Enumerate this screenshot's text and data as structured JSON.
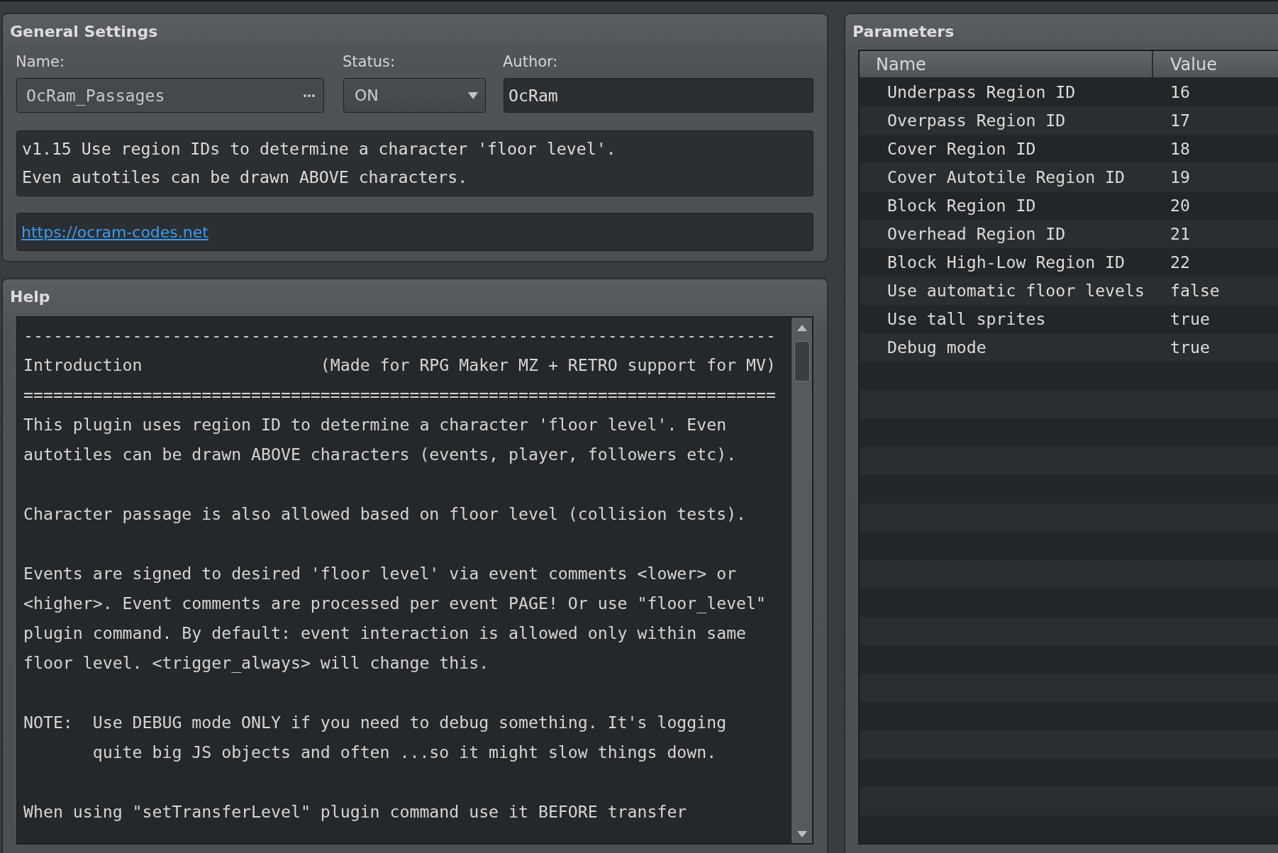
{
  "general_settings": {
    "title": "General Settings",
    "name": {
      "label": "Name:",
      "value": "OcRam_Passages"
    },
    "status": {
      "label": "Status:",
      "value": "ON"
    },
    "author": {
      "label": "Author:",
      "value": "OcRam"
    },
    "description": "v1.15 Use region IDs to determine a character 'floor level'.\nEven autotiles can be drawn ABOVE characters.",
    "url": "https://ocram-codes.net"
  },
  "help": {
    "title": "Help",
    "heading": {
      "rule_top": "----------------------------------------------------------------------------",
      "title": "Introduction",
      "note": "(Made for RPG Maker MZ + RETRO support for MV)",
      "rule_bottom": "============================================================================"
    },
    "paragraphs": [
      "This plugin uses region ID to determine a character 'floor level'. Even\nautotiles can be drawn ABOVE characters (events, player, followers etc).",
      "Character passage is also allowed based on floor level (collision tests).",
      "Events are signed to desired 'floor level' via event comments <lower> or\n<higher>. Event comments are processed per event PAGE! Or use \"floor_level\"\nplugin command. By default: event interaction is allowed only within same\nfloor level. <trigger_always> will change this.",
      "NOTE:  Use DEBUG mode ONLY if you need to debug something. It's logging\n       quite big JS objects and often ...so it might slow things down.",
      "When using \"setTransferLevel\" plugin command use it BEFORE transfer"
    ]
  },
  "parameters": {
    "title": "Parameters",
    "columns": [
      "Name",
      "Value"
    ],
    "rows": [
      {
        "name": "Underpass Region ID",
        "value": "16"
      },
      {
        "name": "Overpass Region ID",
        "value": "17"
      },
      {
        "name": "Cover Region ID",
        "value": "18"
      },
      {
        "name": "Cover Autotile Region ID",
        "value": "19"
      },
      {
        "name": "Block Region ID",
        "value": "20"
      },
      {
        "name": "Overhead Region ID",
        "value": "21"
      },
      {
        "name": "Block High-Low Region ID",
        "value": "22"
      },
      {
        "name": "Use automatic floor levels",
        "value": "false"
      },
      {
        "name": "Use tall sprites",
        "value": "true"
      },
      {
        "name": "Debug mode",
        "value": "true"
      }
    ]
  }
}
